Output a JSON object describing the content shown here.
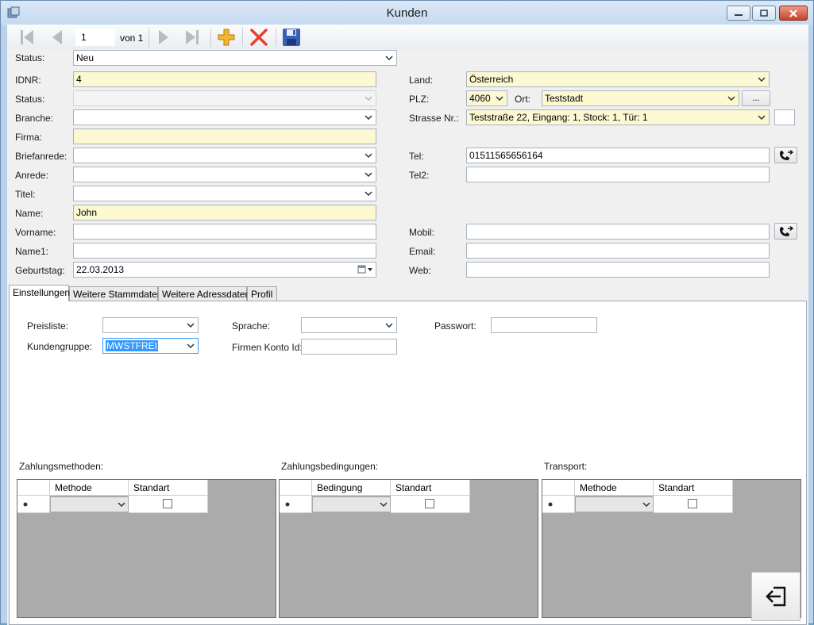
{
  "window": {
    "title": "Kunden"
  },
  "toolbar": {
    "record_value": "1",
    "record_of_label": "von 1"
  },
  "form": {
    "status_top": {
      "label": "Status:",
      "value": "Neu"
    },
    "idnr": {
      "label": "IDNR:",
      "value": "4"
    },
    "status": {
      "label": "Status:",
      "value": ""
    },
    "branche": {
      "label": "Branche:",
      "value": ""
    },
    "firma": {
      "label": "Firma:",
      "value": ""
    },
    "briefanrede": {
      "label": "Briefanrede:",
      "value": ""
    },
    "anrede": {
      "label": "Anrede:",
      "value": ""
    },
    "titel": {
      "label": "Titel:",
      "value": ""
    },
    "name": {
      "label": "Name:",
      "value": "John"
    },
    "vorname": {
      "label": "Vorname:",
      "value": ""
    },
    "name1": {
      "label": "Name1:",
      "value": ""
    },
    "geburtstag": {
      "label": "Geburtstag:",
      "value": "22.03.2013"
    },
    "land": {
      "label": "Land:",
      "value": "Österreich"
    },
    "plz": {
      "label": "PLZ:",
      "value": "4060"
    },
    "ort": {
      "label": "Ort:",
      "value": "Teststadt"
    },
    "ort_button": "...",
    "strasse": {
      "label": "Strasse Nr.:",
      "value": "Teststraße 22, Eingang: 1, Stock: 1, Tür: 1"
    },
    "tel": {
      "label": "Tel:",
      "value": "01511565656164"
    },
    "tel2": {
      "label": "Tel2:",
      "value": ""
    },
    "mobil": {
      "label": "Mobil:",
      "value": ""
    },
    "email": {
      "label": "Email:",
      "value": ""
    },
    "web": {
      "label": "Web:",
      "value": ""
    }
  },
  "tabs": [
    "Einstellungen",
    "Weitere Stammdaten",
    "Weitere Adressdaten",
    "Profil"
  ],
  "settings": {
    "preisliste": {
      "label": "Preisliste:",
      "value": ""
    },
    "kundengruppe": {
      "label": "Kundengruppe:",
      "value": "MWSTFREI"
    },
    "sprache": {
      "label": "Sprache:",
      "value": ""
    },
    "firmen_konto": {
      "label": "Firmen Konto Id:",
      "value": ""
    },
    "passwort": {
      "label": "Passwort:",
      "value": ""
    }
  },
  "grids": [
    {
      "title": "Zahlungsmethoden:",
      "col1": "Methode",
      "col2": "Standart"
    },
    {
      "title": "Zahlungsbedingungen:",
      "col1": "Bedingung",
      "col2": "Standart"
    },
    {
      "title": "Transport:",
      "col1": "Methode",
      "col2": "Standart"
    }
  ],
  "colors": {
    "required_field": "#fbf8d2",
    "selection": "#3399ff",
    "delete_red": "#e8402c",
    "add_gold": "#f3b72c",
    "save_blue": "#3b5fb5"
  }
}
